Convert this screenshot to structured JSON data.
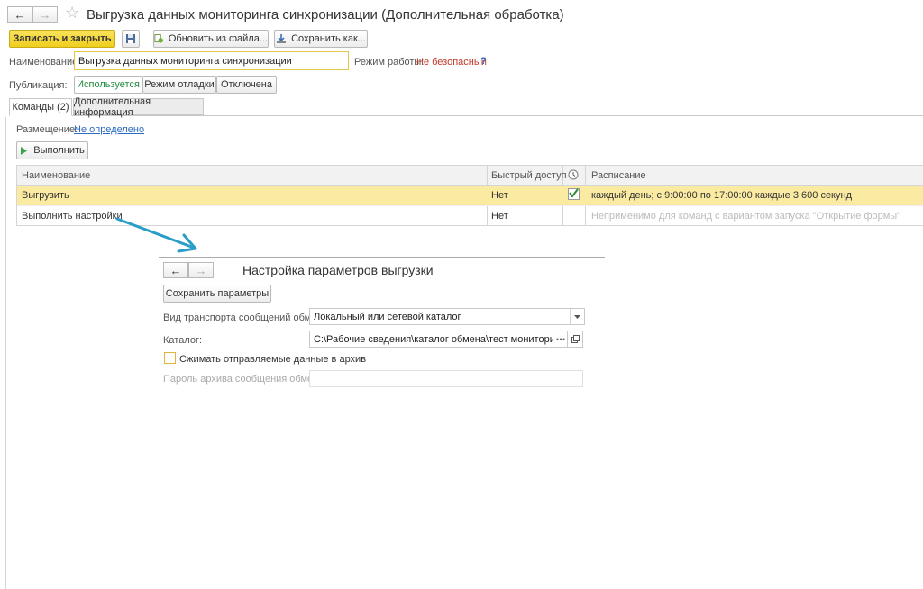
{
  "window": {
    "title": "Выгрузка данных мониторинга синхронизации (Дополнительная обработка)",
    "back_icon": "←",
    "forward_icon": "→",
    "favorite_icon": "☆"
  },
  "toolbar": {
    "save_close_label": "Записать и закрыть",
    "update_from_file_label": "Обновить из файла...",
    "save_as_label": "Сохранить как..."
  },
  "form": {
    "name_label": "Наименование:",
    "name_value": "Выгрузка данных мониторинга синхронизации",
    "mode_label": "Режим работы:",
    "mode_value": "Не безопасный",
    "mode_help": "?",
    "publication_label": "Публикация:",
    "publication_options": [
      "Используется",
      "Режим отладки",
      "Отключена"
    ]
  },
  "tabs": [
    "Команды (2)",
    "Дополнительная информация"
  ],
  "commands": {
    "placement_label": "Размещение:",
    "placement_value": "Не определено",
    "run_label": "Выполнить",
    "columns": [
      "Наименование",
      "Быстрый доступ",
      "Расписание"
    ],
    "rows": [
      {
        "name": "Выгрузить",
        "quick": "Нет",
        "schedule": "каждый день; с 9:00:00 по 17:00:00 каждые 3 600 секунд"
      },
      {
        "name": "Выполнить настройки",
        "quick": "Нет",
        "schedule": "Неприменимо для команд с вариантом запуска \"Открытие формы\""
      }
    ]
  },
  "dialog": {
    "title": "Настройка параметров выгрузки",
    "save_params_label": "Сохранить параметры",
    "transport_label": "Вид транспорта сообщений обмена:",
    "transport_value": "Локальный или сетевой каталог",
    "catalog_label": "Каталог:",
    "catalog_value": "C:\\Рабочие сведения\\каталог обмена\\тест мониторинг",
    "compress_label": "Сжимать отправляемые данные в архив",
    "archive_password_label": "Пароль архива сообщения обмена:",
    "archive_password_value": ""
  },
  "colors": {
    "accent_yellow": "#f5d83b",
    "selected_row": "#fbeaa2",
    "link": "#2d6cc0",
    "danger": "#c0392b",
    "arrow": "#2a9ec7"
  }
}
